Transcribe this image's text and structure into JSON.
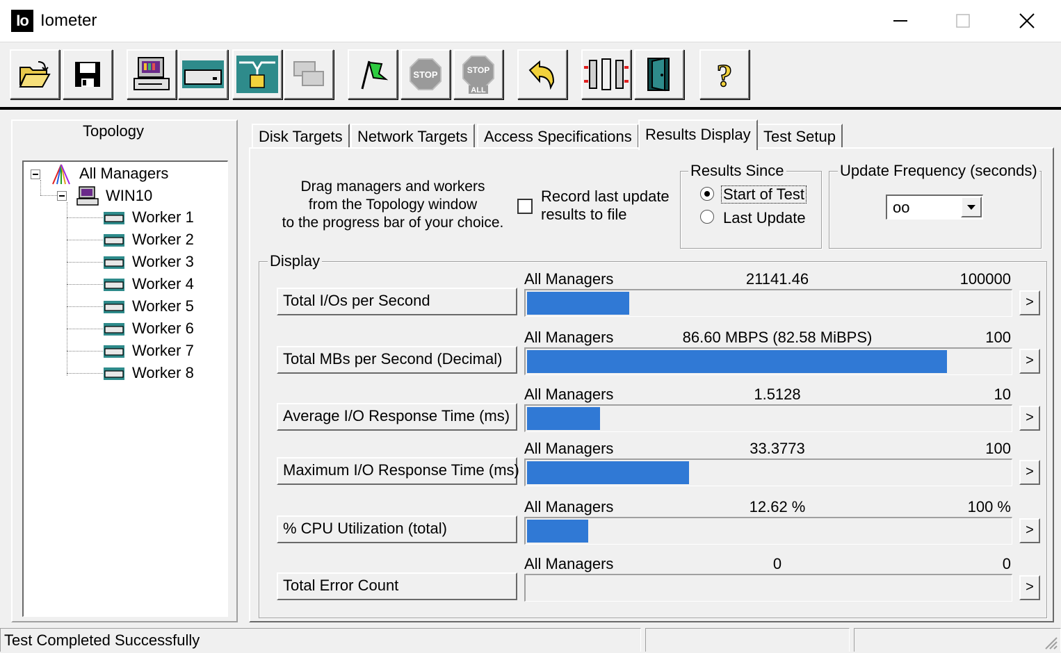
{
  "window": {
    "app_icon_text": "Io",
    "title": "Iometer",
    "controls": [
      "minimize-icon",
      "maximize-icon",
      "close-icon"
    ]
  },
  "toolbar": {
    "buttons": [
      {
        "name": "open-config",
        "icon": "folder-open-icon"
      },
      {
        "name": "save-config",
        "icon": "floppy-disk-icon"
      },
      {
        "name": "start-manager",
        "icon": "computer-icon"
      },
      {
        "name": "start-disk-worker",
        "icon": "disk-worker-icon"
      },
      {
        "name": "start-network-worker",
        "icon": "network-worker-icon"
      },
      {
        "name": "duplicate-worker",
        "icon": "duplicate-icon"
      },
      {
        "name": "start-tests",
        "icon": "green-flag-icon"
      },
      {
        "name": "stop-test",
        "icon": "stop-sign-icon",
        "label": "STOP"
      },
      {
        "name": "stop-all",
        "icon": "stop-all-icon",
        "label": "STOP",
        "sublabel": "ALL"
      },
      {
        "name": "reset-workers",
        "icon": "reset-arrow-icon"
      },
      {
        "name": "disconnect-workers",
        "icon": "disconnect-icon"
      },
      {
        "name": "exit",
        "icon": "exit-door-icon"
      },
      {
        "name": "help",
        "icon": "question-mark-icon",
        "label": "?"
      }
    ]
  },
  "topology": {
    "title": "Topology",
    "root": "All Managers",
    "manager": "WIN10",
    "workers": [
      "Worker 1",
      "Worker 2",
      "Worker 3",
      "Worker 4",
      "Worker 5",
      "Worker 6",
      "Worker 7",
      "Worker 8"
    ]
  },
  "tabs": [
    {
      "label": "Disk Targets",
      "active": false
    },
    {
      "label": "Network Targets",
      "active": false
    },
    {
      "label": "Access Specifications",
      "active": false
    },
    {
      "label": "Results Display",
      "active": true
    },
    {
      "label": "Test Setup",
      "active": false
    }
  ],
  "results": {
    "hint_lines": [
      "Drag managers and workers",
      "from the Topology window",
      "to the progress bar of your choice."
    ],
    "record_checkbox": {
      "label_lines": [
        "Record last update",
        "results to file"
      ],
      "checked": false
    },
    "results_since": {
      "title": "Results Since",
      "options": [
        {
          "label": "Start of Test",
          "selected": true
        },
        {
          "label": "Last Update",
          "selected": false
        }
      ]
    },
    "update_frequency": {
      "title": "Update Frequency (seconds)",
      "value": "oo"
    },
    "display_title": "Display",
    "more_label": ">",
    "rows": [
      {
        "metric": "Total I/Os per Second",
        "target": "All Managers",
        "value": "21141.46",
        "max": "100000",
        "fill_fraction": 0.211
      },
      {
        "metric": "Total MBs per Second (Decimal)",
        "target": "All Managers",
        "value": "86.60 MBPS (82.58 MiBPS)",
        "max": "100",
        "fill_fraction": 0.866
      },
      {
        "metric": "Average I/O Response Time (ms)",
        "target": "All Managers",
        "value": "1.5128",
        "max": "10",
        "fill_fraction": 0.151
      },
      {
        "metric": "Maximum I/O Response Time (ms)",
        "target": "All Managers",
        "value": "33.3773",
        "max": "100",
        "fill_fraction": 0.334
      },
      {
        "metric": "% CPU Utilization (total)",
        "target": "All Managers",
        "value": "12.62 %",
        "max": "100 %",
        "fill_fraction": 0.126
      },
      {
        "metric": "Total Error Count",
        "target": "All Managers",
        "value": "0",
        "max": "0",
        "fill_fraction": 0
      }
    ]
  },
  "status": {
    "text": "Test Completed Successfully"
  },
  "colors": {
    "bar": "#3079d5",
    "window_bg": "#f0f0f0"
  }
}
